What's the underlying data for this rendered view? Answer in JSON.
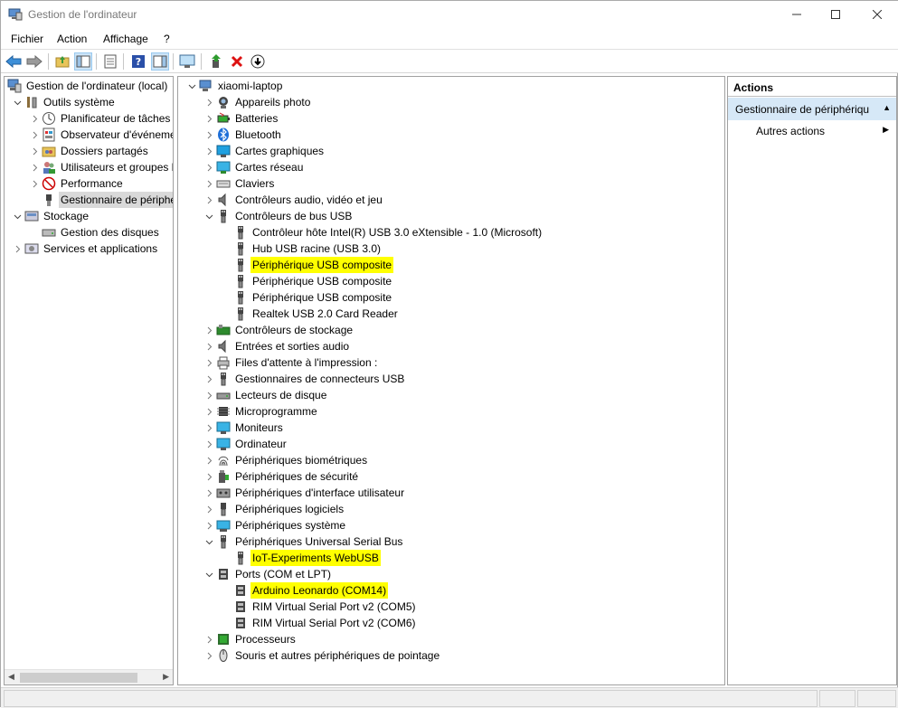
{
  "window": {
    "title": "Gestion de l'ordinateur"
  },
  "menu": [
    "Fichier",
    "Action",
    "Affichage",
    "?"
  ],
  "left_tree": [
    {
      "label": "Gestion de l'ordinateur (local)",
      "icon": "computer-management-icon",
      "level": 0,
      "expander": ""
    },
    {
      "label": "Outils système",
      "icon": "tools-icon",
      "level": 1,
      "expander": "open"
    },
    {
      "label": "Planificateur de tâches",
      "icon": "clock-icon",
      "level": 2,
      "expander": "closed"
    },
    {
      "label": "Observateur d'événeme",
      "icon": "event-viewer-icon",
      "level": 2,
      "expander": "closed"
    },
    {
      "label": "Dossiers partagés",
      "icon": "shared-folder-icon",
      "level": 2,
      "expander": "closed"
    },
    {
      "label": "Utilisateurs et groupes l",
      "icon": "users-icon",
      "level": 2,
      "expander": "closed"
    },
    {
      "label": "Performance",
      "icon": "performance-icon",
      "level": 2,
      "expander": "closed"
    },
    {
      "label": "Gestionnaire de périphé",
      "icon": "device-manager-icon",
      "level": 2,
      "expander": "",
      "selected": true
    },
    {
      "label": "Stockage",
      "icon": "storage-icon",
      "level": 1,
      "expander": "open"
    },
    {
      "label": "Gestion des disques",
      "icon": "disk-icon",
      "level": 2,
      "expander": ""
    },
    {
      "label": "Services et applications",
      "icon": "services-icon",
      "level": 1,
      "expander": "closed"
    }
  ],
  "device_tree": [
    {
      "label": "xiaomi-laptop",
      "icon": "computer-icon",
      "level": 0,
      "expander": "open"
    },
    {
      "label": "Appareils photo",
      "icon": "camera-icon",
      "level": 1,
      "expander": "closed"
    },
    {
      "label": "Batteries",
      "icon": "battery-icon",
      "level": 1,
      "expander": "closed"
    },
    {
      "label": "Bluetooth",
      "icon": "bluetooth-icon",
      "level": 1,
      "expander": "closed"
    },
    {
      "label": "Cartes graphiques",
      "icon": "display-adapter-icon",
      "level": 1,
      "expander": "closed"
    },
    {
      "label": "Cartes réseau",
      "icon": "network-icon",
      "level": 1,
      "expander": "closed"
    },
    {
      "label": "Claviers",
      "icon": "keyboard-icon",
      "level": 1,
      "expander": "closed"
    },
    {
      "label": "Contrôleurs audio, vidéo et jeu",
      "icon": "speaker-icon",
      "level": 1,
      "expander": "closed"
    },
    {
      "label": "Contrôleurs de bus USB",
      "icon": "usb-icon",
      "level": 1,
      "expander": "open"
    },
    {
      "label": "Contrôleur hôte Intel(R) USB 3.0 eXtensible - 1.0 (Microsoft)",
      "icon": "usb-icon",
      "level": 2,
      "expander": ""
    },
    {
      "label": "Hub USB racine (USB 3.0)",
      "icon": "usb-icon",
      "level": 2,
      "expander": ""
    },
    {
      "label": "Périphérique USB composite",
      "icon": "usb-icon",
      "level": 2,
      "expander": "",
      "highlight": true
    },
    {
      "label": "Périphérique USB composite",
      "icon": "usb-icon",
      "level": 2,
      "expander": ""
    },
    {
      "label": "Périphérique USB composite",
      "icon": "usb-icon",
      "level": 2,
      "expander": ""
    },
    {
      "label": "Realtek USB 2.0 Card Reader",
      "icon": "usb-icon",
      "level": 2,
      "expander": ""
    },
    {
      "label": "Contrôleurs de stockage",
      "icon": "storage-controller-icon",
      "level": 1,
      "expander": "closed"
    },
    {
      "label": "Entrées et sorties audio",
      "icon": "speaker-icon",
      "level": 1,
      "expander": "closed"
    },
    {
      "label": "Files d'attente à l'impression :",
      "icon": "printer-icon",
      "level": 1,
      "expander": "closed"
    },
    {
      "label": "Gestionnaires de connecteurs USB",
      "icon": "usb-icon",
      "level": 1,
      "expander": "closed"
    },
    {
      "label": "Lecteurs de disque",
      "icon": "disk-drive-icon",
      "level": 1,
      "expander": "closed"
    },
    {
      "label": "Microprogramme",
      "icon": "chip-icon",
      "level": 1,
      "expander": "closed"
    },
    {
      "label": "Moniteurs",
      "icon": "monitor-icon",
      "level": 1,
      "expander": "closed"
    },
    {
      "label": "Ordinateur",
      "icon": "monitor-icon",
      "level": 1,
      "expander": "closed"
    },
    {
      "label": "Périphériques biométriques",
      "icon": "fingerprint-icon",
      "level": 1,
      "expander": "closed"
    },
    {
      "label": "Périphériques de sécurité",
      "icon": "security-icon",
      "level": 1,
      "expander": "closed"
    },
    {
      "label": "Périphériques d'interface utilisateur",
      "icon": "hid-icon",
      "level": 1,
      "expander": "closed"
    },
    {
      "label": "Périphériques logiciels",
      "icon": "software-device-icon",
      "level": 1,
      "expander": "closed"
    },
    {
      "label": "Périphériques système",
      "icon": "system-device-icon",
      "level": 1,
      "expander": "closed"
    },
    {
      "label": "Périphériques Universal Serial Bus",
      "icon": "usb-icon",
      "level": 1,
      "expander": "open"
    },
    {
      "label": "IoT-Experiments WebUSB",
      "icon": "usb-icon",
      "level": 2,
      "expander": "",
      "highlight": true
    },
    {
      "label": "Ports (COM et LPT)",
      "icon": "port-icon",
      "level": 1,
      "expander": "open"
    },
    {
      "label": "Arduino Leonardo (COM14)",
      "icon": "port-icon",
      "level": 2,
      "expander": "",
      "highlight": true
    },
    {
      "label": "RIM Virtual Serial Port v2 (COM5)",
      "icon": "port-icon",
      "level": 2,
      "expander": ""
    },
    {
      "label": "RIM Virtual Serial Port v2 (COM6)",
      "icon": "port-icon",
      "level": 2,
      "expander": ""
    },
    {
      "label": "Processeurs",
      "icon": "processor-icon",
      "level": 1,
      "expander": "closed"
    },
    {
      "label": "Souris et autres périphériques de pointage",
      "icon": "mouse-icon",
      "level": 1,
      "expander": "closed"
    }
  ],
  "actions": {
    "header": "Actions",
    "section": "Gestionnaire de périphériqu",
    "item": "Autres actions"
  },
  "colors": {
    "highlight": "#ffff00",
    "selected": "#d9d9d9",
    "actions_section": "#d6e8f7"
  }
}
